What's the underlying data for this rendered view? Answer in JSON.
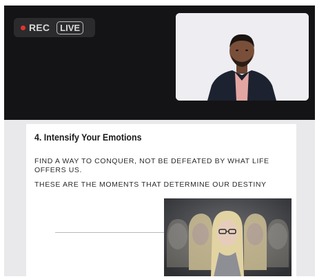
{
  "recording": {
    "rec_label": "REC",
    "live_label": "LIVE",
    "rec_color": "#e0342b"
  },
  "video": {
    "participant_tile": "camera feed"
  },
  "slide": {
    "title": "4. Intensify Your Emotions",
    "line1": "FIND A WAY TO CONQUER, NOT BE DEFEATED BY WHAT LIFE OFFERS US.",
    "line2": "THESE ARE THE MOMENTS THAT DETERMINE OUR DESTINY"
  },
  "colors": {
    "top_bar": "#141416",
    "slide_bg": "#ffffff",
    "page_bg": "#e9e9ec"
  }
}
